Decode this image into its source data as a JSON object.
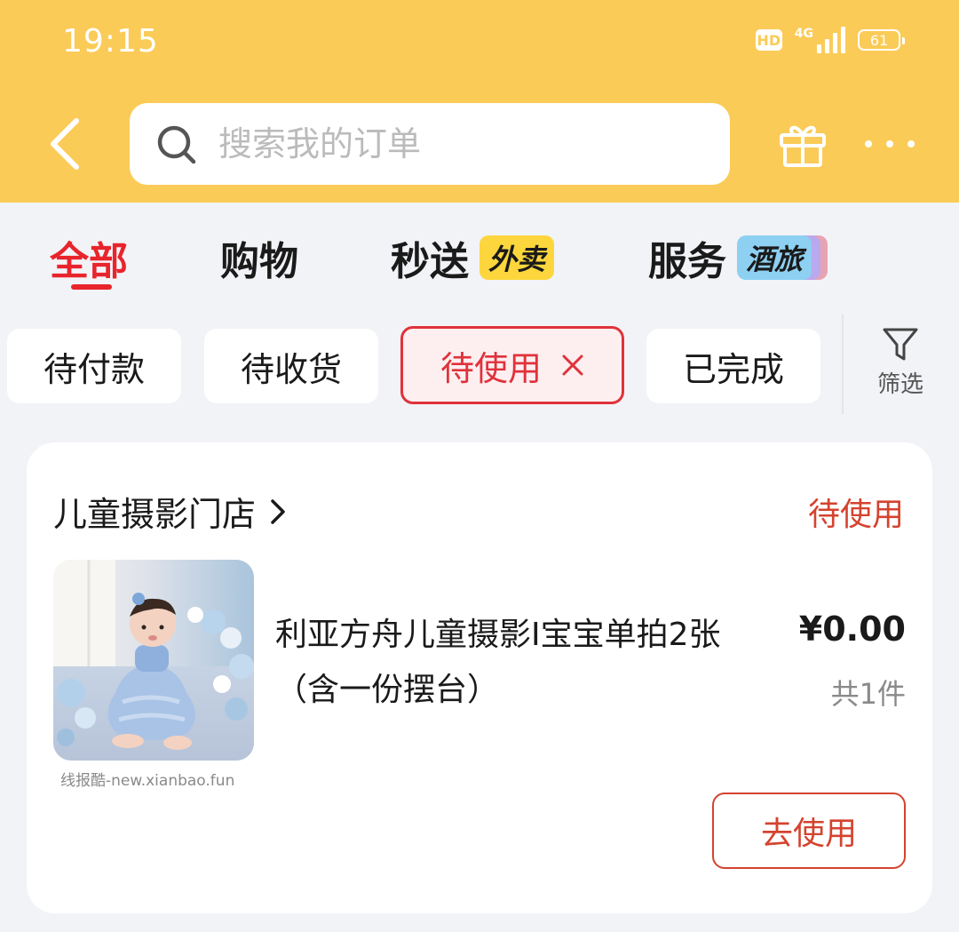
{
  "status_bar": {
    "time": "19:15",
    "hd_label": "HD",
    "network_label": "4G",
    "battery_level": "61"
  },
  "search": {
    "placeholder": "搜索我的订单"
  },
  "category_tabs": [
    {
      "label": "全部",
      "active": true
    },
    {
      "label": "购物",
      "active": false
    },
    {
      "label": "秒送",
      "badge": "外卖",
      "active": false
    },
    {
      "label": "服务",
      "badge": "酒旅",
      "active": false
    }
  ],
  "status_filters": [
    {
      "label": "待付款",
      "active": false
    },
    {
      "label": "待收货",
      "active": false
    },
    {
      "label": "待使用",
      "active": true
    },
    {
      "label": "已完成",
      "active": false
    }
  ],
  "filter_button": {
    "label": "筛选"
  },
  "order": {
    "shop_name": "儿童摄影门店",
    "status": "待使用",
    "product_title": "利亚方舟儿童摄影I宝宝单拍2张（含一份摆台）",
    "price": "¥0.00",
    "quantity": "共1件",
    "action_label": "去使用",
    "image_watermark": "线报酷-new.xianbao.fun"
  },
  "colors": {
    "header_bg": "#fbcb58",
    "accent_red": "#e8242c",
    "status_red": "#d4432f",
    "page_bg": "#f2f3f7"
  }
}
